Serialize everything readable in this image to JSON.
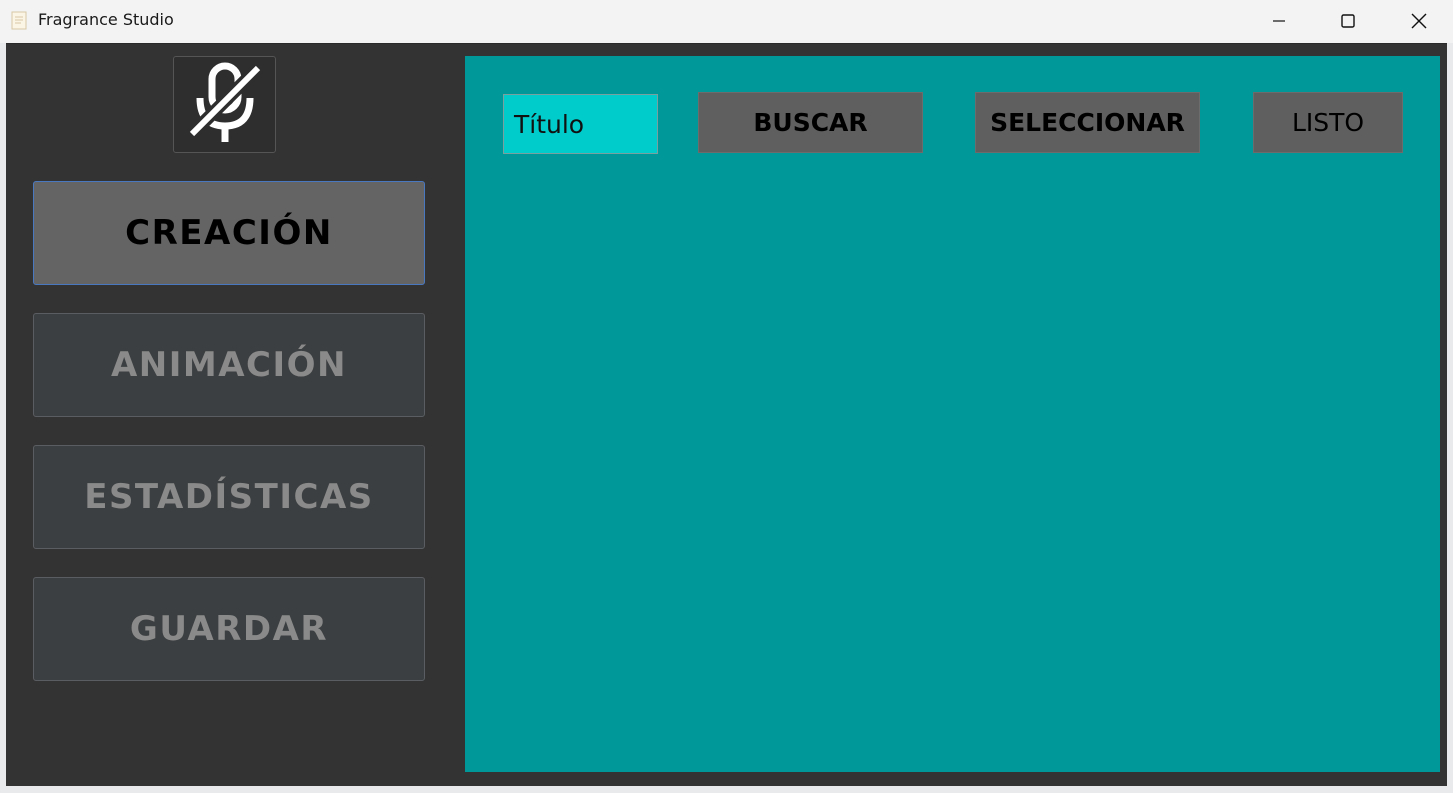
{
  "window": {
    "title": "Fragrance Studio",
    "controls": [
      "minimize",
      "maximize",
      "close"
    ]
  },
  "sidebar": {
    "logo_icon": "muted-microphone-icon",
    "items": [
      {
        "label": "CREACIÓN",
        "active": true
      },
      {
        "label": "ANIMACIÓN",
        "active": false
      },
      {
        "label": "ESTADÍSTICAS",
        "active": false
      },
      {
        "label": "GUARDAR",
        "active": false
      }
    ]
  },
  "main": {
    "title_field_value": "Título",
    "buttons": {
      "buscar": "BUSCAR",
      "seleccionar": "SELECCIONAR",
      "listo": "LISTO"
    }
  },
  "colors": {
    "sidebar_bg": "#333333",
    "main_panel": "#009898",
    "title_field": "#00cccc",
    "active_tab": "#646464",
    "inactive_tab": "#3c3f41"
  }
}
